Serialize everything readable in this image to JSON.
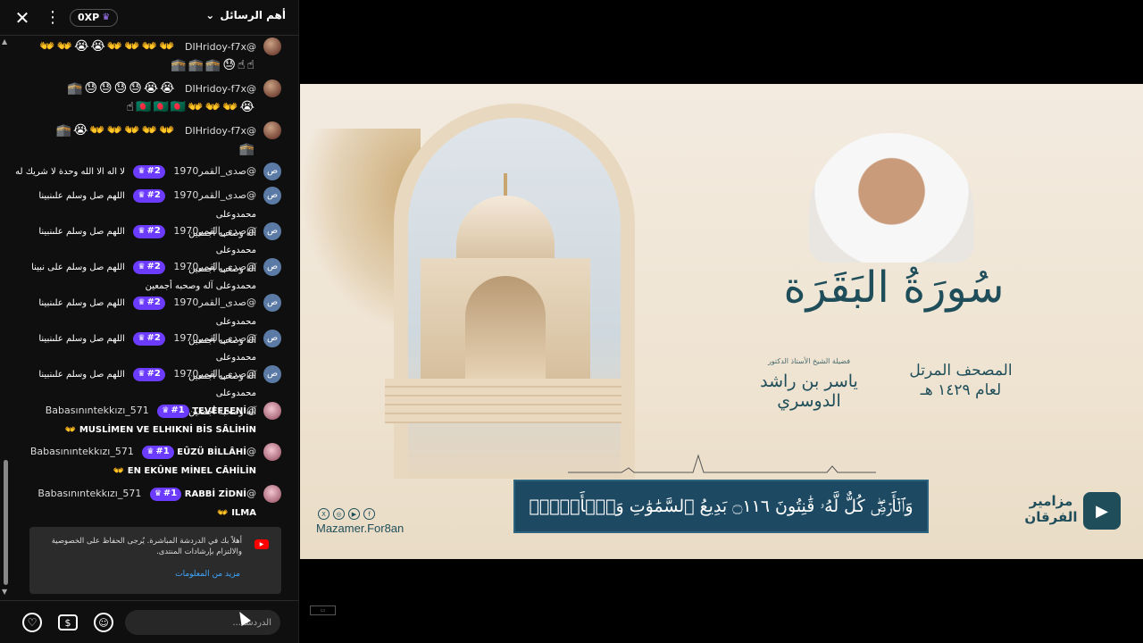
{
  "header": {
    "xp_label": "0XP",
    "top_messages_label": "أهم الرسائل"
  },
  "messages": [
    {
      "author": "@DIHridoy-f7x",
      "line1": "👐👐👐👐😭😭👐👐",
      "line2": "☝☝😓🕋🕋🕋"
    },
    {
      "author": "@DIHridoy-f7x",
      "line1": "😭😭😓😓😓😓🕋",
      "line2": "😭👐👐👐🇧🇩🇧🇩🇧🇩☝"
    },
    {
      "author": "@DIHridoy-f7x",
      "line1": "👐👐👐👐👐😭🕋",
      "line2": "🕋"
    },
    {
      "author": "@صدى_القمر1970",
      "avatar": "ص",
      "rank": "#2",
      "line1": "لا اله الا الله وحدة لا شريك له",
      "line2": ""
    },
    {
      "author": "@صدى_القمر1970",
      "avatar": "ص",
      "rank": "#2",
      "line1": "اللهم صل وسلم علىنبينا محمدوعلى",
      "line2": "آله وصحبه أجمعين"
    },
    {
      "author": "@صدى_القمر1970",
      "avatar": "ص",
      "rank": "#2",
      "line1": "اللهم صل وسلم علىنبينا محمدوعلى",
      "line2": "آله وصحبه أجمعين"
    },
    {
      "author": "@صدى_القمر1970",
      "avatar": "ص",
      "rank": "#2",
      "line1": "اللهم صل وسلم على نبينا",
      "line2": "محمدوعلى آله وصحبه أجمعين"
    },
    {
      "author": "@صدى_القمر1970",
      "avatar": "ص",
      "rank": "#2",
      "line1": "اللهم صل وسلم علىنبينا محمدوعلى",
      "line2": "آله وصحبه أجمعين"
    },
    {
      "author": "@صدى_القمر1970",
      "avatar": "ص",
      "rank": "#2",
      "line1": "اللهم صل وسلم علىنبينا محمدوعلى",
      "line2": "آله وصحبه أجمعين"
    },
    {
      "author": "@صدى_القمر1970",
      "avatar": "ص",
      "rank": "#2",
      "line1": "اللهم صل وسلم علىنبينا محمدوعلى",
      "line2": "آله وصحبه أجمعين"
    },
    {
      "author": "@Babasınıntekkızı_571",
      "rank": "#1",
      "line1": "TEVEFFENİ",
      "line2": "MUSLİMEN VE ELHIKNİ BİS SÂLİHİN 👐"
    },
    {
      "author": "@Babasınıntekkızı_571",
      "rank": "#1",
      "line1": "EÛZÜ BİLLÂHİ",
      "line2": "EN EKÛNE MİNEL CÂHİLİN 👐"
    },
    {
      "author": "@Babasınıntekkızı_571",
      "rank": "#1",
      "line1": "RABBİ ZİDNİ",
      "line2": "ILMA 👐"
    }
  ],
  "notice": {
    "text": "أهلاً بك في الدردشة المباشرة. يُرجى الحفاظ على الخصوصية والالتزام بإرشادات المنتدى.",
    "more_link": "مزيد من المعلومات"
  },
  "footer": {
    "input_placeholder": "الدردشة..."
  },
  "video": {
    "surah_title": "سُورَةُ البَقَرَة",
    "reciter_caption": "فضيلة الشيخ الأستاذ الدكتور",
    "reciter_name": "ياسر بن راشد الدوسري",
    "mushaf_line1": "المصحف المرتل",
    "mushaf_line2": "لعام ١٤٢٩ هـ",
    "verse": "وَٱلۡأَرۡضِۖ كُلٌّ لَّهُۥ قَٰنِتُونَ ۝١١٦ بَدِيعُ ٱلسَّمَٰوَٰتِ وَٱلۡأَرۡضِۖ",
    "handle": "Mazamer.For8an",
    "logo_line1": "مزامير",
    "logo_line2": "الفرقان"
  },
  "icons": {
    "close": "close-icon",
    "menu": "more-vert-icon",
    "crown": "crown-icon",
    "heart": "heart-icon",
    "dollar": "super-chat-icon",
    "emoji": "emoji-icon"
  },
  "colors": {
    "rank_badge": "#6b3cff",
    "link": "#3ea6ff",
    "verse_box": "#1d4a62"
  }
}
